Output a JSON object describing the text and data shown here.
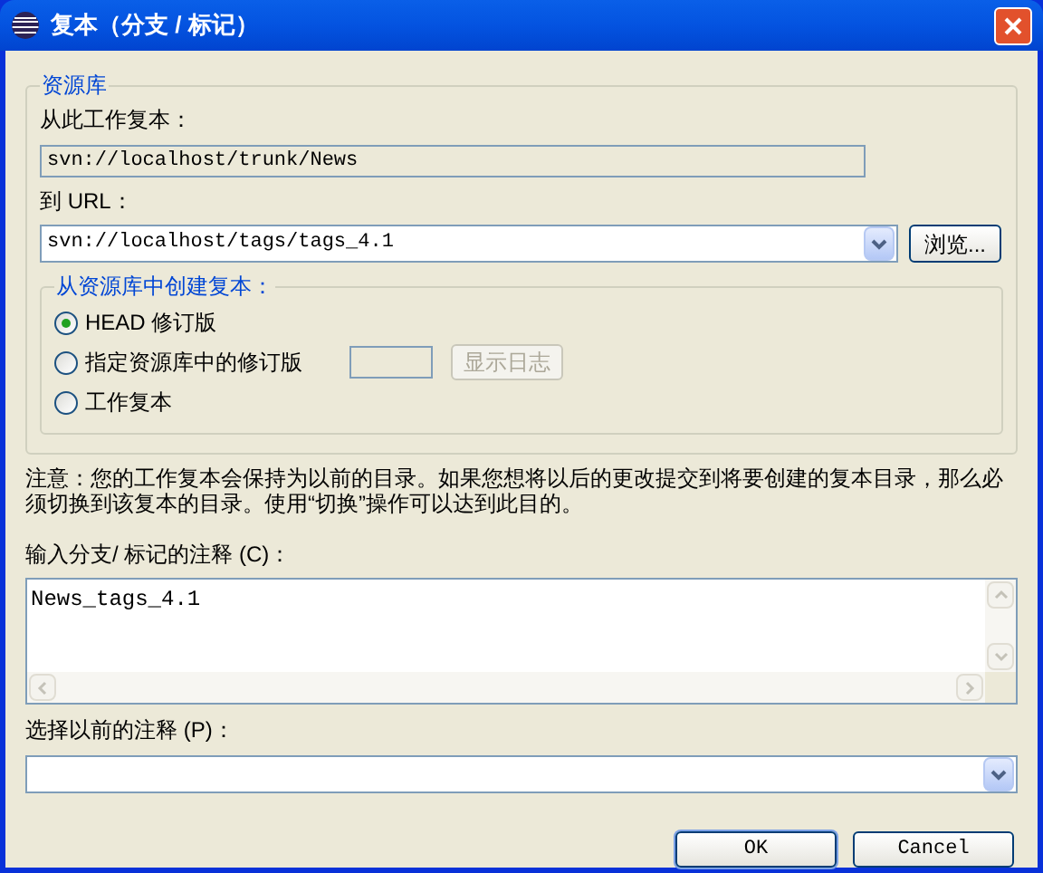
{
  "window": {
    "title": "复本（分支 / 标记）"
  },
  "repository": {
    "legend": "资源库",
    "from_label": "从此工作复本：",
    "from_value": "svn://localhost/trunk/News",
    "to_label": "到 URL：",
    "to_value": "svn://localhost/tags/tags_4.1",
    "browse_button": "浏览..."
  },
  "create_from": {
    "legend": "从资源库中创建复本：",
    "options": [
      {
        "label": "HEAD 修订版",
        "selected": true
      },
      {
        "label": "指定资源库中的修订版",
        "selected": false,
        "log_button": {
          "label": "显示日志",
          "disabled": true
        }
      },
      {
        "label": "工作复本",
        "selected": false
      }
    ]
  },
  "note": "注意：您的工作复本会保持为以前的目录。如果您想将以后的更改提交到将要创建的复本目录，那么必须切换到该复本的目录。使用“切换”操作可以达到此目的。",
  "comment": {
    "label": "输入分支/ 标记的注释 (C)：",
    "value": "News_tags_4.1"
  },
  "previous": {
    "label": "选择以前的注释 (P)："
  },
  "buttons": [
    "OK",
    "Cancel"
  ]
}
